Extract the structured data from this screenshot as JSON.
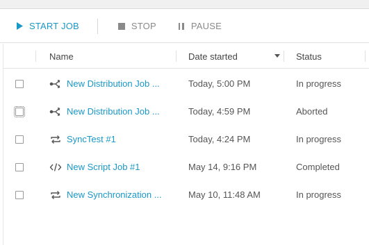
{
  "toolbar": {
    "start_label": "START JOB",
    "stop_label": "STOP",
    "pause_label": "PAUSE"
  },
  "table": {
    "columns": [
      "Name",
      "Date started",
      "Status"
    ],
    "sorted_column": "Date started",
    "sort_direction": "descending",
    "rows": [
      {
        "icon": "distribution-icon",
        "name": "New Distribution Job ...",
        "date": "Today, 5:00 PM",
        "status": "In progress"
      },
      {
        "icon": "distribution-icon",
        "name": "New Distribution Job ...",
        "date": "Today, 4:59 PM",
        "status": "Aborted"
      },
      {
        "icon": "sync-icon",
        "name": "SyncTest #1",
        "date": "Today, 4:24 PM",
        "status": "In progress"
      },
      {
        "icon": "script-icon",
        "name": "New Script Job #1",
        "date": "May 14, 9:16 PM",
        "status": "Completed"
      },
      {
        "icon": "sync-icon",
        "name": "New Synchronization ...",
        "date": "May 10, 11:48 AM",
        "status": "In progress"
      }
    ]
  },
  "colors": {
    "accent": "#1a98c7",
    "muted": "#8a8a8a",
    "text": "#555555"
  }
}
